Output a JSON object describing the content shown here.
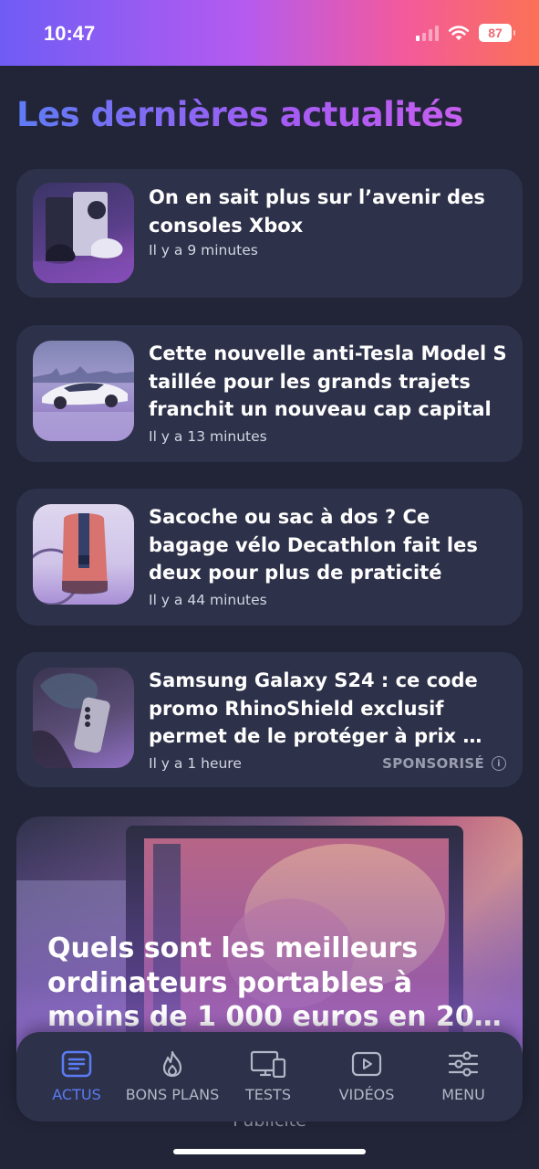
{
  "status_bar": {
    "time": "10:47",
    "battery": "87",
    "icons": [
      "signal-icon",
      "wifi-icon",
      "battery-icon"
    ]
  },
  "page_title": "Les dernières actualités",
  "articles": [
    {
      "title": "On en sait plus sur l’avenir des consoles Xbox",
      "time": "Il y a 9 minutes",
      "image": "xbox-consoles-thumbnail"
    },
    {
      "title": "Cette nouvelle anti-Tesla Model S taillée pour les grands trajets franchit un nouveau cap capital",
      "time": "Il y a 13 minutes",
      "image": "car-thumbnail"
    },
    {
      "title": "Sacoche ou sac à dos ? Ce bagage vélo Decathlon fait les deux pour plus de praticité",
      "time": "Il y a 44 minutes",
      "image": "bike-bag-thumbnail"
    },
    {
      "title": "Samsung Galaxy S24 : ce code promo RhinoShield exclusif permet de le protéger à prix …",
      "time": "Il y a 1 heure",
      "badge": "SPONSORISÉ",
      "image": "phone-thumbnail"
    }
  ],
  "feature": {
    "title": "Quels sont les meilleurs ordinateurs portables à moins de 1 000 euros en 20…",
    "image": "laptop-feature-image"
  },
  "advert_label": "Publicité",
  "tabs": [
    {
      "label": "ACTUS",
      "icon": "news-icon",
      "active": true
    },
    {
      "label": "BONS PLANS",
      "icon": "flame-icon",
      "active": false
    },
    {
      "label": "TESTS",
      "icon": "devices-icon",
      "active": false
    },
    {
      "label": "VIDÉOS",
      "icon": "video-play-icon",
      "active": false
    },
    {
      "label": "MENU",
      "icon": "sliders-icon",
      "active": false
    }
  ],
  "colors": {
    "accent": "#5a7cf5",
    "card_bg": "#2d3149",
    "page_bg": "#222538",
    "status_gradient_start": "#6f5cf5",
    "status_gradient_end": "#fb7156"
  }
}
